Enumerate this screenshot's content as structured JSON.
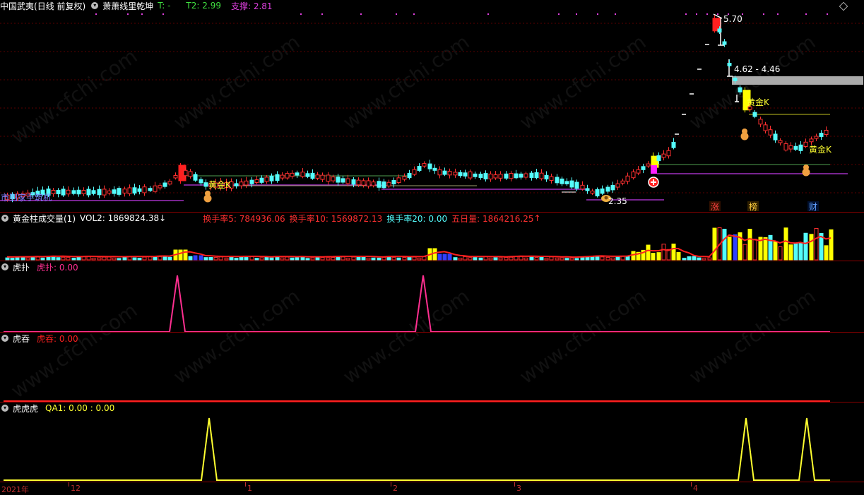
{
  "main": {
    "stock_name": "中国武夷",
    "period": "(日线 前复权)",
    "indicator": "萧萧线里乾坤",
    "t_label": "T: -",
    "t2": "T2: 2.99",
    "support": "支撑: 2.81",
    "high_label": "5.70",
    "range_label": "4.62 - 4.46",
    "low_label": "2.35",
    "gold_k_1": "黄金K",
    "gold_k_2": "黄金K",
    "gold_k_3": "黄金K",
    "left_text": "市到家手筑机",
    "marker_zhang": "涨",
    "marker_bang": "榜",
    "marker_cai": "财"
  },
  "vol": {
    "title": "黄金柱成交量(1)",
    "vol2": "VOL2: 1869824.38",
    "hs5": "换手率5: 784936.06",
    "hs10": "换手率10: 1569872.13",
    "hs20": "换手率20: 0.00",
    "wrl": "五日量: 1864216.25"
  },
  "hupu": {
    "title": "虎扑",
    "label": "虎扑: 0.00"
  },
  "huti": {
    "title": "虎吞",
    "label": "虎吞: 0.00"
  },
  "huhu": {
    "title": "虎虎虎",
    "label": "QA1: 0.00  : 0.00"
  },
  "xaxis": {
    "year": "2021年",
    "m12": "12",
    "m1": "1",
    "m2": "2",
    "m3": "3",
    "m4": "4"
  },
  "colors": {
    "up": "#ff3030",
    "down": "#54fcfc",
    "gold": "#ffff00",
    "magenta": "#ff2fa0",
    "purple": "#b030d0"
  },
  "icons": {
    "collapse": "chevron-down-icon",
    "diamond": "diamond-icon"
  },
  "watermark": "www.cfchi.com"
}
